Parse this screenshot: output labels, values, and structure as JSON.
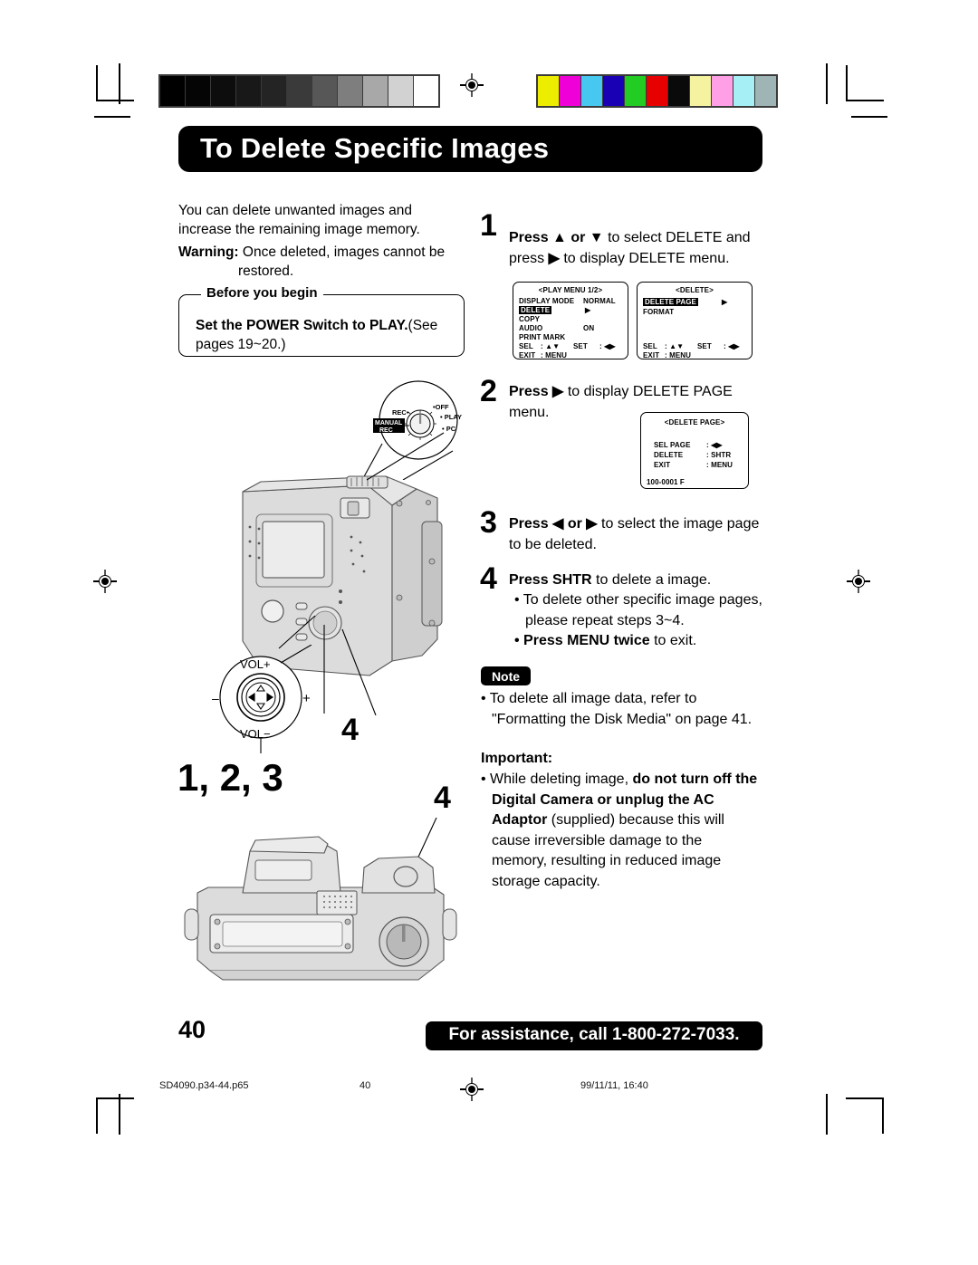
{
  "page": {
    "title": "To Delete Specific Images",
    "number": "40"
  },
  "intro": {
    "paragraph": "You can delete unwanted images and increase the remaining image memory.",
    "warning_label": "Warning:",
    "warning_text": "Once deleted, images cannot be",
    "warning_text2": "restored."
  },
  "before_you_begin": {
    "legend": "Before you begin",
    "bold": "Set  the POWER Switch to PLAY.",
    "rest": "(See",
    "line2": "pages  19~20.)"
  },
  "steps": [
    {
      "number": "1",
      "bold": "Press",
      "text_a": "to select DELETE and",
      "text_b": "press",
      "text_c": "to display DELETE menu."
    },
    {
      "number": "2",
      "bold": "Press",
      "text_a": "to display DELETE PAGE",
      "text_b": "menu."
    },
    {
      "number": "3",
      "bold": "Press",
      "bold_or": "or",
      "text_a": "to select the image page",
      "text_b": "to be deleted."
    },
    {
      "number": "4",
      "bold": "Press SHTR",
      "text_a": "to delete a image.",
      "bullets": [
        "• To delete other specific image pages,",
        "  please repeat steps 3~4."
      ],
      "bullet_bold_prefix": "• Press MENU twice",
      "bullet_bold_rest": "to exit."
    }
  ],
  "lcd_play_menu": {
    "title": "<PLAY MENU 1/2>",
    "rows": [
      {
        "label": "DISPLAY MODE",
        "value": "NORMAL"
      },
      {
        "label": "DELETE",
        "value": "▶",
        "selected": true
      },
      {
        "label": "COPY",
        "value": ""
      },
      {
        "label": "AUDIO",
        "value": "ON"
      },
      {
        "label": "PRINT MARK",
        "value": ""
      }
    ],
    "sel": "SEL",
    "sel_val": ": ▲▼",
    "set": "SET",
    "set_val": ": ◀▶",
    "exit": "EXIT",
    "exit_val": ": MENU"
  },
  "lcd_delete": {
    "title": "<DELETE>",
    "rows": [
      {
        "label": "DELETE PAGE",
        "value": "▶",
        "selected": true
      },
      {
        "label": "FORMAT",
        "value": ""
      }
    ],
    "sel": "SEL",
    "sel_val": ": ▲▼",
    "set": "SET",
    "set_val": ": ◀▶",
    "exit": "EXIT",
    "exit_val": ": MENU"
  },
  "lcd_delete_page": {
    "title": "<DELETE PAGE>",
    "rows": [
      {
        "label": "SEL PAGE",
        "value": ": ◀▶"
      },
      {
        "label": "DELETE",
        "value": ": SHTR"
      },
      {
        "label": "EXIT",
        "value": ": MENU"
      }
    ],
    "file_counter": "100-0001 F"
  },
  "note": {
    "badge": "Note",
    "line1": "• To delete all image data, refer to",
    "line2": "  \"Formatting the Disk Media\" on page 41."
  },
  "important": {
    "heading": "Important:",
    "l1_plain": "• While deleting image, ",
    "l1_bold": "do not turn off the",
    "l2_bold": "Digital Camera or unplug the AC",
    "l3_bold": "Adaptor",
    "l3_plain": " (supplied) because this will",
    "l4": "cause irreversible damage to the",
    "l5": "memory, resulting in reduced image",
    "l6": "storage capacity."
  },
  "dial_callout": {
    "manual_rec_l1": "MANUAL",
    "manual_rec_l2": "REC",
    "rec": "REC",
    "off": "OFF",
    "play": "PLAY",
    "pc": "PC"
  },
  "vol_callout": {
    "vol_up": "VOL+",
    "vol_down": "VOL−",
    "minus": "–",
    "plus": "+"
  },
  "figure_labels": {
    "left": "1, 2, 3",
    "right_top": "4",
    "right_bottom": "4"
  },
  "footer": {
    "assistance": "For assistance, call 1-800-272-7033.",
    "file": "SD4090.p34-44.p65",
    "page": "40",
    "timestamp": "99/11/11, 16:40"
  },
  "colorbar": {
    "grayscale": [
      "#000000",
      "#050505",
      "#0d0d0d",
      "#181818",
      "#242424",
      "#3a3a3a",
      "#575757",
      "#7e7e7e",
      "#a8a8a8",
      "#d2d2d2",
      "#ffffff"
    ],
    "colors": [
      "#eded00",
      "#f000d8",
      "#46c8f0",
      "#1a00b4",
      "#22cc22",
      "#e60000",
      "#0a0a0a",
      "#f5f2a0",
      "#ffa0e6",
      "#a6f0f5",
      "#9fb4b4"
    ]
  }
}
